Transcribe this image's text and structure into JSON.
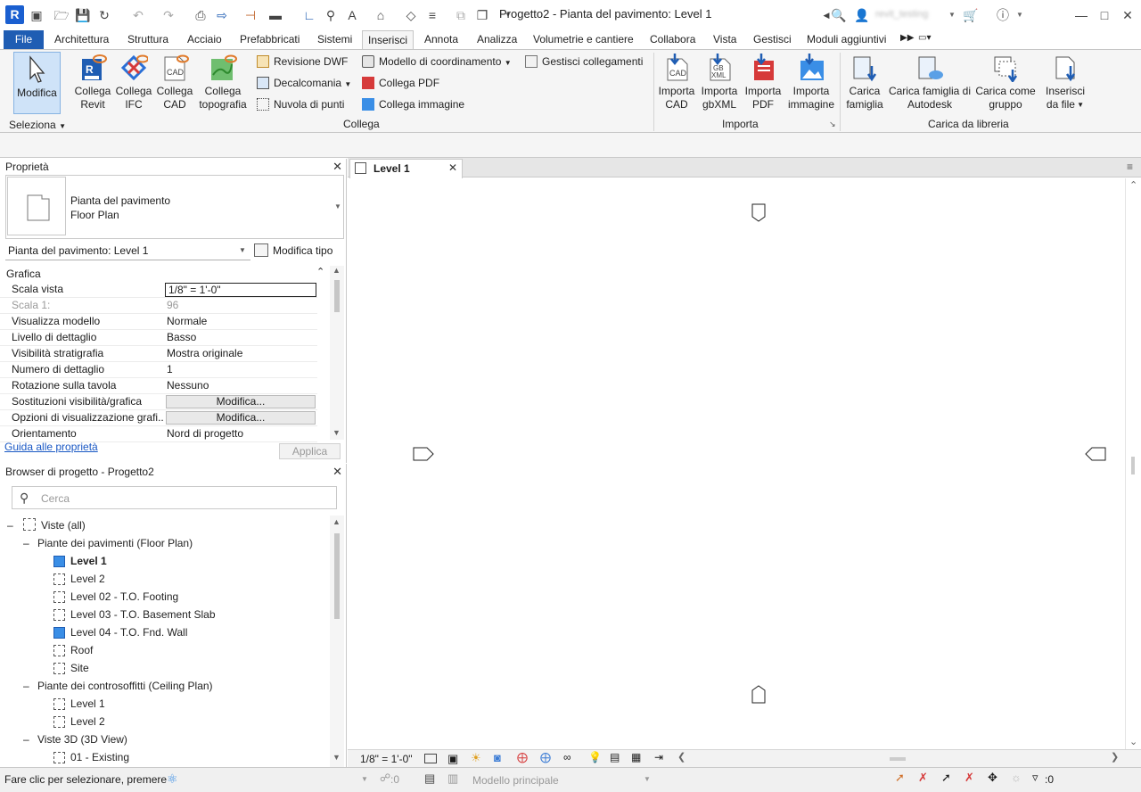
{
  "app": {
    "logo": "R",
    "title": "Progetto2 - Pianta del pavimento: Level 1",
    "user": "revit_testing"
  },
  "menu": {
    "file": "File",
    "tabs": [
      "Architettura",
      "Struttura",
      "Acciaio",
      "Prefabbricati",
      "Sistemi",
      "Inserisci",
      "Annota",
      "Analizza",
      "Volumetrie e cantiere",
      "Collabora",
      "Vista",
      "Gestisci",
      "Moduli aggiuntivi"
    ],
    "active": "Inserisci"
  },
  "ribbon": {
    "modify": "Modifica",
    "select_panel": "Seleziona",
    "collega": {
      "revit": [
        "Collega",
        "Revit"
      ],
      "ifc": [
        "Collega",
        "IFC"
      ],
      "cad": [
        "Collega",
        "CAD"
      ],
      "topo": [
        "Collega",
        "topografia"
      ],
      "dwf": "Revisione DWF",
      "decal": "Decalcomania",
      "cloud": "Nuvola di punti",
      "coord": "Modello di coordinamento",
      "pdf": "Collega  PDF",
      "image": "Collega  immagine",
      "manage": "Gestisci  collegamenti",
      "panel": "Collega"
    },
    "importa": {
      "cad": [
        "Importa",
        "CAD"
      ],
      "gbxml": [
        "Importa",
        "gbXML"
      ],
      "pdf": [
        "Importa",
        "PDF"
      ],
      "image": [
        "Importa",
        "immagine"
      ],
      "panel": "Importa"
    },
    "libreria": {
      "load_family": [
        "Carica",
        "famiglia"
      ],
      "autodesk": [
        "Carica famiglia di",
        "Autodesk"
      ],
      "group": [
        "Carica come",
        "gruppo"
      ],
      "from_file": [
        "Inserisci",
        "da file"
      ],
      "panel": "Carica da libreria"
    }
  },
  "properties": {
    "title": "Proprietà",
    "type_line1": "Pianta del pavimento",
    "type_line2": "Floor Plan",
    "instance": "Pianta del pavimento: Level 1",
    "edit_type": "Modifica tipo",
    "group": "Grafica",
    "rows": [
      {
        "k": "Scala vista",
        "v": "1/8\" = 1'-0\""
      },
      {
        "k": "Scala  1:",
        "v": "96"
      },
      {
        "k": "Visualizza modello",
        "v": "Normale"
      },
      {
        "k": "Livello di dettaglio",
        "v": "Basso"
      },
      {
        "k": "Visibilità stratigrafia",
        "v": "Mostra originale"
      },
      {
        "k": "Numero di dettaglio",
        "v": "1"
      },
      {
        "k": "Rotazione sulla tavola",
        "v": "Nessuno"
      },
      {
        "k": "Sostituzioni visibilità/grafica",
        "v": "Modifica..."
      },
      {
        "k": "Opzioni di visualizzazione grafi...",
        "v": "Modifica..."
      },
      {
        "k": "Orientamento",
        "v": "Nord di progetto"
      }
    ],
    "help": "Guida alle proprietà",
    "apply": "Applica"
  },
  "browser": {
    "title": "Browser di progetto - Progetto2",
    "search": "Cerca",
    "root": "Viste (all)",
    "floor_group": "Piante dei pavimenti (Floor Plan)",
    "floor_items": [
      "Level 1",
      "Level 2",
      "Level 02 - T.O. Footing",
      "Level 03 - T.O. Basement Slab",
      "Level 04 - T.O. Fnd. Wall",
      "Roof",
      "Site"
    ],
    "ceiling_group": "Piante dei controsoffitti (Ceiling Plan)",
    "ceiling_items": [
      "Level 1",
      "Level 2"
    ],
    "view3d_group": "Viste 3D (3D View)",
    "view3d_items": [
      "01 - Existing"
    ]
  },
  "view": {
    "tab": "Level 1",
    "scale": "1/8\" = 1'-0\""
  },
  "status": {
    "message": "Fare clic per selezionare, premere",
    "zero1": ":0",
    "model": "Modello principale",
    "filter": ":0"
  }
}
